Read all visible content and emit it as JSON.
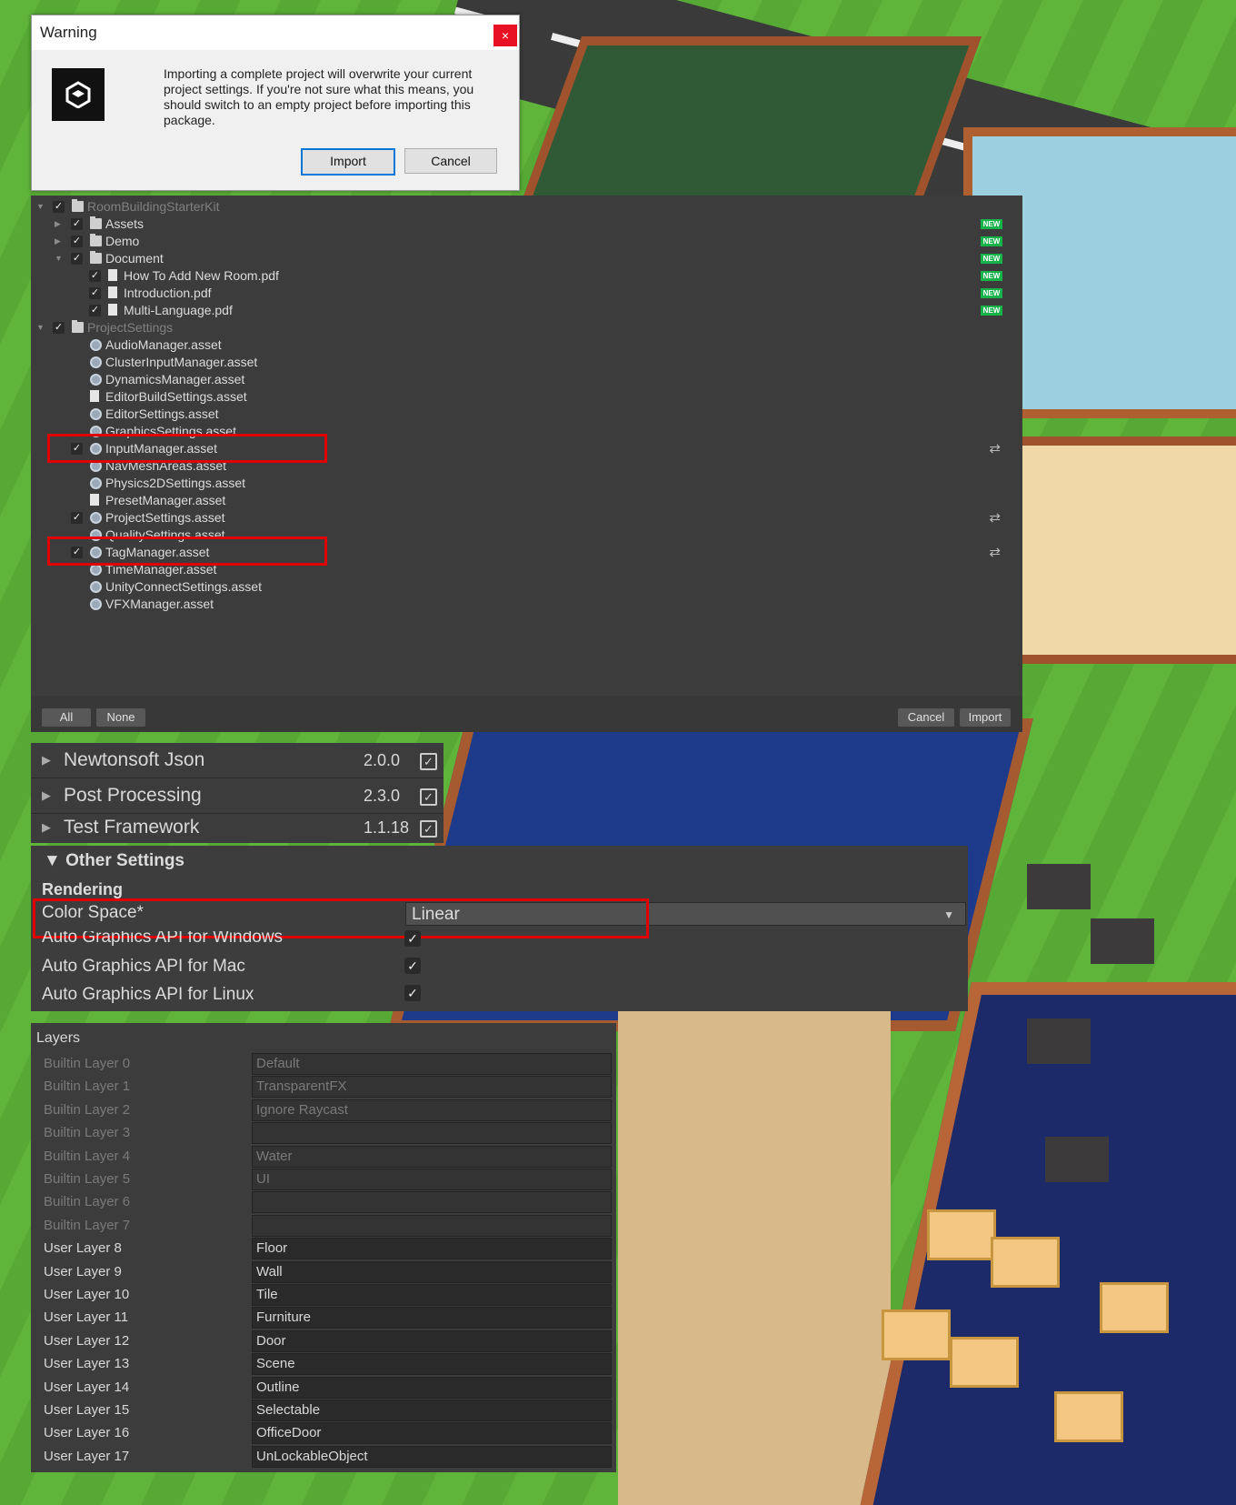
{
  "warning_dialog": {
    "title": "Warning",
    "close": "×",
    "message": "Importing a complete project will overwrite your current project settings. If you're not sure what this means, you should switch to an empty project before importing this package.",
    "import_label": "Import",
    "cancel_label": "Cancel"
  },
  "import_package": {
    "new_badge": "NEW",
    "swap_icon": "⇄",
    "check": "✓",
    "items": [
      {
        "label": "RoomBuildingStarterKit",
        "type": "folder",
        "indent": 0,
        "arrow": "▼",
        "checked": true,
        "dim": true
      },
      {
        "label": "Assets",
        "type": "folder",
        "indent": 1,
        "arrow": "▶",
        "checked": true,
        "new": true
      },
      {
        "label": "Demo",
        "type": "folder",
        "indent": 1,
        "arrow": "▶",
        "checked": true,
        "new": true
      },
      {
        "label": "Document",
        "type": "folder",
        "indent": 1,
        "arrow": "▼",
        "checked": true,
        "new": true
      },
      {
        "label": "How To Add New Room.pdf",
        "type": "file",
        "indent": 2,
        "checked": true,
        "new": true
      },
      {
        "label": "Introduction.pdf",
        "type": "file",
        "indent": 2,
        "checked": true,
        "new": true
      },
      {
        "label": "Multi-Language.pdf",
        "type": "file",
        "indent": 2,
        "checked": true,
        "new": true
      },
      {
        "label": "ProjectSettings",
        "type": "folder",
        "indent": 0,
        "arrow": "▼",
        "checked": true,
        "dim": true
      },
      {
        "label": "AudioManager.asset",
        "type": "gear",
        "indent": 1
      },
      {
        "label": "ClusterInputManager.asset",
        "type": "gear",
        "indent": 1
      },
      {
        "label": "DynamicsManager.asset",
        "type": "gear",
        "indent": 1
      },
      {
        "label": "EditorBuildSettings.asset",
        "type": "file",
        "indent": 1
      },
      {
        "label": "EditorSettings.asset",
        "type": "gear",
        "indent": 1
      },
      {
        "label": "GraphicsSettings.asset",
        "type": "gear",
        "indent": 1
      },
      {
        "label": "InputManager.asset",
        "type": "gear",
        "indent": 1,
        "checked": true,
        "swap": true,
        "highlight": true
      },
      {
        "label": "NavMeshAreas.asset",
        "type": "gear",
        "indent": 1
      },
      {
        "label": "Physics2DSettings.asset",
        "type": "gear",
        "indent": 1
      },
      {
        "label": "PresetManager.asset",
        "type": "file",
        "indent": 1
      },
      {
        "label": "ProjectSettings.asset",
        "type": "gear",
        "indent": 1,
        "checked": true,
        "swap": true
      },
      {
        "label": "QualitySettings.asset",
        "type": "gear",
        "indent": 1
      },
      {
        "label": "TagManager.asset",
        "type": "gear",
        "indent": 1,
        "checked": true,
        "swap": true,
        "highlight": true
      },
      {
        "label": "TimeManager.asset",
        "type": "gear",
        "indent": 1
      },
      {
        "label": "UnityConnectSettings.asset",
        "type": "gear",
        "indent": 1
      },
      {
        "label": "VFXManager.asset",
        "type": "gear",
        "indent": 1
      }
    ],
    "footer": {
      "all": "All",
      "none": "None",
      "cancel": "Cancel",
      "import": "Import"
    }
  },
  "packages": [
    {
      "name": "Newtonsoft Json",
      "version": "2.0.0"
    },
    {
      "name": "Post Processing",
      "version": "2.3.0"
    },
    {
      "name": "Test Framework",
      "version": "1.1.18"
    }
  ],
  "other_settings": {
    "header": "Other Settings",
    "section": "Rendering",
    "color_space_label": "Color Space*",
    "color_space_value": "Linear",
    "rows": [
      "Auto Graphics API  for Windows",
      "Auto Graphics API  for Mac",
      "Auto Graphics API  for Linux"
    ]
  },
  "layers": {
    "header": "Layers",
    "rows": [
      {
        "name": "Builtin Layer 0",
        "value": "Default",
        "builtin": true
      },
      {
        "name": "Builtin Layer 1",
        "value": "TransparentFX",
        "builtin": true
      },
      {
        "name": "Builtin Layer 2",
        "value": "Ignore Raycast",
        "builtin": true
      },
      {
        "name": "Builtin Layer 3",
        "value": "",
        "builtin": true
      },
      {
        "name": "Builtin Layer 4",
        "value": "Water",
        "builtin": true
      },
      {
        "name": "Builtin Layer 5",
        "value": "UI",
        "builtin": true
      },
      {
        "name": "Builtin Layer 6",
        "value": "",
        "builtin": true
      },
      {
        "name": "Builtin Layer 7",
        "value": "",
        "builtin": true
      },
      {
        "name": "User Layer 8",
        "value": "Floor"
      },
      {
        "name": "User Layer 9",
        "value": "Wall"
      },
      {
        "name": "User Layer 10",
        "value": "Tile"
      },
      {
        "name": "User Layer 11",
        "value": "Furniture"
      },
      {
        "name": "User Layer 12",
        "value": "Door"
      },
      {
        "name": "User Layer 13",
        "value": "Scene"
      },
      {
        "name": "User Layer 14",
        "value": "Outline"
      },
      {
        "name": "User Layer 15",
        "value": "Selectable"
      },
      {
        "name": "User Layer 16",
        "value": "OfficeDoor"
      },
      {
        "name": "User Layer 17",
        "value": "UnLockableObject"
      }
    ]
  },
  "colors": {
    "highlight": "#e10000",
    "new_badge": "#16b34a",
    "panel": "#3c3c3c"
  }
}
